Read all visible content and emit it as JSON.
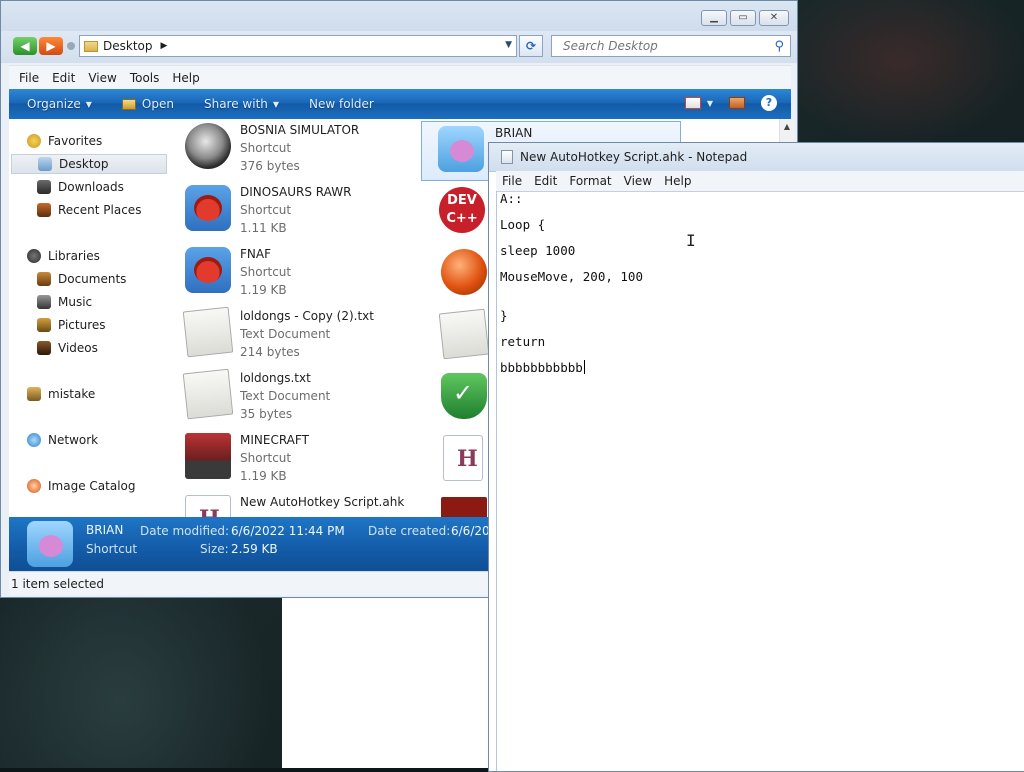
{
  "explorer": {
    "address": "Desktop",
    "search_placeholder": "Search Desktop",
    "menu": [
      "File",
      "Edit",
      "View",
      "Tools",
      "Help"
    ],
    "commands": {
      "organize": "Organize",
      "open": "Open",
      "share_with": "Share with",
      "new_folder": "New folder"
    },
    "nav": {
      "favorites": "Favorites",
      "desktop": "Desktop",
      "downloads": "Downloads",
      "recent_places": "Recent Places",
      "libraries": "Libraries",
      "documents": "Documents",
      "music": "Music",
      "pictures": "Pictures",
      "videos": "Videos",
      "mistake": "mistake",
      "network": "Network",
      "image_catalog": "Image Catalog"
    },
    "files": [
      {
        "name": "BOSNIA SIMULATOR",
        "type": "Shortcut",
        "size": "376 bytes",
        "icon": "mace-icon"
      },
      {
        "name": "DINOSAURS RAWR",
        "type": "Shortcut",
        "size": "1.11 KB",
        "icon": "angry-bird-icon"
      },
      {
        "name": "FNAF",
        "type": "Shortcut",
        "size": "1.19 KB",
        "icon": "angry-bird-icon"
      },
      {
        "name": "loldongs - Copy (2).txt",
        "type": "Text Document",
        "size": "214 bytes",
        "icon": "text-document-icon"
      },
      {
        "name": "loldongs.txt",
        "type": "Text Document",
        "size": "35 bytes",
        "icon": "text-document-icon"
      },
      {
        "name": "MINECRAFT",
        "type": "Shortcut",
        "size": "1.19 KB",
        "icon": "minecraft-icon"
      },
      {
        "name": "New AutoHotkey Script.ahk",
        "type": "",
        "size": "",
        "icon": "autohotkey-script-icon"
      }
    ],
    "files_col2": [
      {
        "name": "BRIAN",
        "icon": "brian-icon"
      },
      {
        "name": "",
        "icon": "dev-cpp-icon",
        "label": "DEV\nC++"
      },
      {
        "name": "",
        "icon": "paint-ball-icon"
      },
      {
        "name": "",
        "icon": "text-document-icon"
      },
      {
        "name": "",
        "icon": "shield-check-icon"
      },
      {
        "name": "",
        "icon": "autohotkey-icon"
      },
      {
        "name": "",
        "icon": "flash-icon"
      }
    ],
    "details": {
      "name": "BRIAN",
      "type": "Shortcut",
      "modified_label": "Date modified:",
      "modified_value": "6/6/2022 11:44 PM",
      "size_label": "Size:",
      "size_value": "2.59 KB",
      "created_label": "Date created:",
      "created_value": "6/6/20"
    },
    "status": "1 item selected"
  },
  "notepad": {
    "title": "New AutoHotkey Script.ahk - Notepad",
    "menu": [
      "File",
      "Edit",
      "Format",
      "View",
      "Help"
    ],
    "lines": [
      "A::",
      "Loop {",
      "sleep 1000",
      "MouseMove, 200, 100",
      "",
      "}",
      "return",
      "bbbbbbbbbbb"
    ]
  },
  "colors": {
    "command_bar": "#1a68b9",
    "selection": "#dcebfc"
  }
}
